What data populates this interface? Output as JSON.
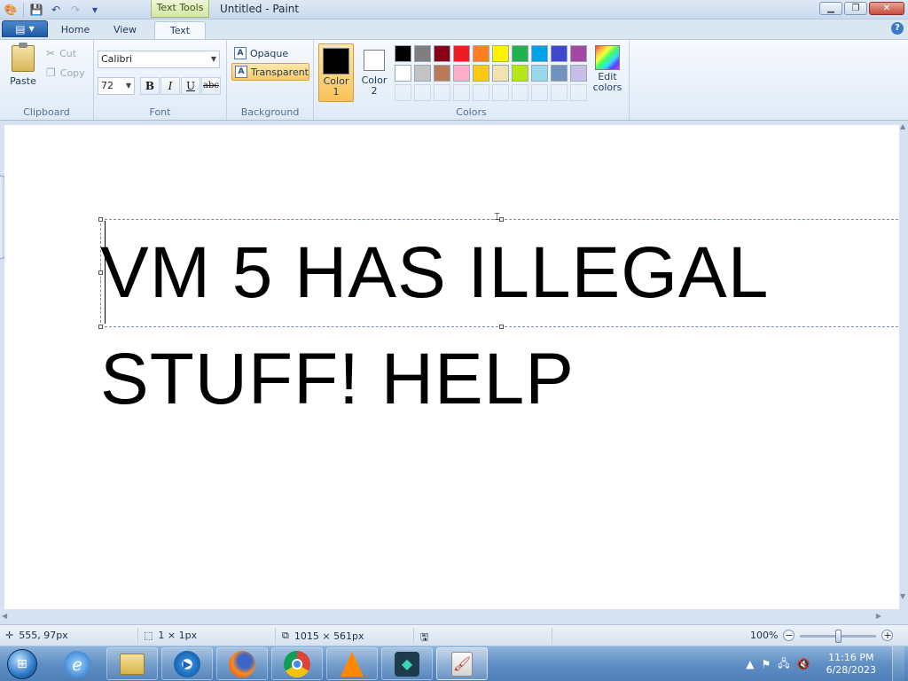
{
  "title_bar": {
    "context_tab": "Text Tools",
    "window_title": "Untitled - Paint",
    "icons": [
      "paint-app-icon",
      "save-icon",
      "undo-icon",
      "redo-icon",
      "customize-qat-icon"
    ]
  },
  "tabs": {
    "home": "Home",
    "view": "View",
    "text": "Text",
    "active": "Text"
  },
  "ribbon": {
    "clipboard": {
      "paste": "Paste",
      "cut": "Cut",
      "copy": "Copy",
      "group_label": "Clipboard"
    },
    "font": {
      "family": "Calibri",
      "size": "72",
      "bold": "B",
      "italic": "I",
      "underline": "U",
      "strikethrough": "abc",
      "group_label": "Font"
    },
    "background": {
      "opaque": "Opaque",
      "transparent": "Transparent",
      "selected": "Transparent",
      "group_label": "Background"
    },
    "colors": {
      "color1_line1": "Color",
      "color1_line2": "1",
      "color2_line1": "Color",
      "color2_line2": "2",
      "color1_value": "#000000",
      "color2_value": "#ffffff",
      "edit_line1": "Edit",
      "edit_line2": "colors",
      "group_label": "Colors",
      "palette_row1": [
        "#000000",
        "#7f7f7f",
        "#880015",
        "#ed1c24",
        "#ff7f27",
        "#fff200",
        "#22b14c",
        "#00a2e8",
        "#3f48cc",
        "#a349a4"
      ],
      "palette_row2": [
        "#ffffff",
        "#c3c3c3",
        "#b97a57",
        "#ffaec9",
        "#ffc90e",
        "#efe4b0",
        "#b5e61d",
        "#99d9ea",
        "#7092be",
        "#c8bfe7"
      ]
    }
  },
  "canvas": {
    "line1": "VM 5 HAS ILLEGAL",
    "line2": "STUFF! HELP",
    "text_color": "#000000"
  },
  "status_bar": {
    "cursor_position": "555, 97px",
    "selection_size": "1 × 1px",
    "canvas_size": "1015 × 561px",
    "zoom": "100%"
  },
  "taskbar": {
    "apps": [
      "start-button",
      "internet-explorer",
      "file-explorer",
      "windows-media-player",
      "firefox",
      "chrome",
      "vlc",
      "app-s",
      "paint"
    ],
    "time": "11:16 PM",
    "date": "6/28/2023"
  }
}
